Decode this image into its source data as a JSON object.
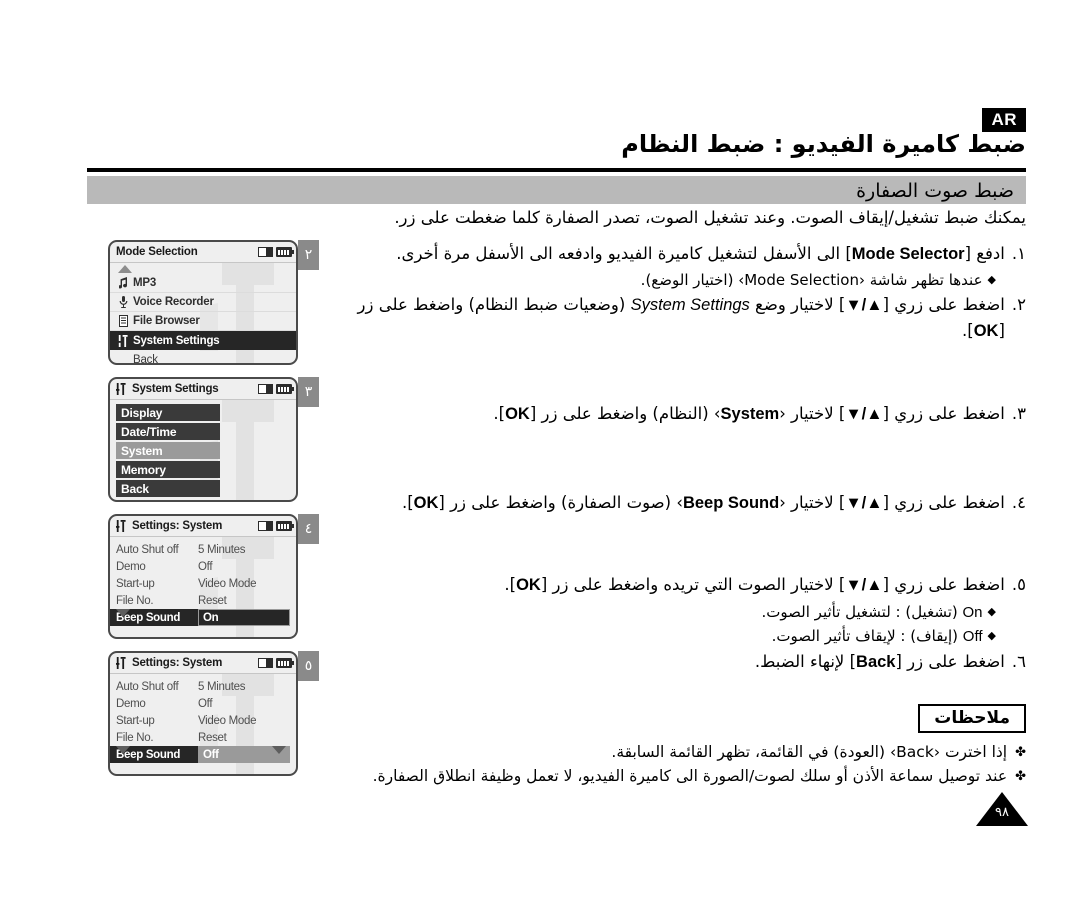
{
  "header": {
    "language_badge": "AR",
    "title": "ضبط كاميرة الفيديو : ضبط النظام",
    "subtitle": "ضبط صوت الصفارة"
  },
  "intro": "يمكنك ضبط تشغيل/إيقاف الصوت. وعند تشغيل الصوت، تصدر الصفارة كلما ضغطت على زر.",
  "steps": [
    {
      "number": "١.",
      "text_before": "ادفع [",
      "latin": "Mode Selector",
      "text_after": "] الى الأسفل لتشغيل كاميرة الفيديو وادفعه الى الأسفل مرة أخرى.",
      "sub": "عندها تظهر شاشة ‹Mode Selection› (اختيار الوضع)."
    },
    {
      "number": "٢.",
      "text_before": "اضغط على زري [",
      "latin": "▼/▲",
      "mid": "] لاختيار وضع",
      "latin2": "System Settings",
      "text_after": "(وضعيات ضبط النظام) واضغط على زر [",
      "latin3": "OK",
      "tail": "]."
    },
    {
      "number": "٣.",
      "text_before": "اضغط على زري [",
      "latin": "▼/▲",
      "mid": "] لاختيار ‹",
      "latin2": "System",
      "text_after": "› (النظام) واضغط على زر [",
      "latin3": "OK",
      "tail": "]."
    },
    {
      "number": "٤.",
      "text_before": "اضغط على زري [",
      "latin": "▼/▲",
      "mid": "] لاختيار ‹",
      "latin2": "Beep Sound",
      "text_after": "› (صوت الصفارة) واضغط على زر [",
      "latin3": "OK",
      "tail": "]."
    },
    {
      "number": "٥.",
      "text_before": "اضغط على زري [",
      "latin": "▼/▲",
      "mid": "] لاختيار الصوت التي تريده واضغط على زر [",
      "latin3": "OK",
      "tail": "].",
      "sub_on": "(تشغيل) : لتشغيل تأثير الصوت.",
      "sub_on_latin": "On",
      "sub_off": "(إيقاف) : لإيقاف تأثير الصوت.",
      "sub_off_latin": "Off"
    },
    {
      "number": "٦.",
      "text_before": "اضغط على زر [",
      "latin": "Back",
      "text_after": "] لإنهاء الضبط."
    }
  ],
  "notes": {
    "title": "ملاحظات",
    "bullet": "✤",
    "items": [
      "إذا اخترت ‹Back› (العودة) في القائمة، تظهر القائمة السابقة.",
      "عند توصيل سماعة الأذن أو سلك لصوت/الصورة الى كاميرة الفيديو، لا تعمل وظيفة انطلاق الصفارة."
    ]
  },
  "page_number": "٩٨",
  "screens": [
    {
      "badge": "٢",
      "title": "Mode Selection",
      "type": "mode-list",
      "items": [
        {
          "icon": "music-note-icon",
          "label": "MP3",
          "state": "normal"
        },
        {
          "icon": "microphone-icon",
          "label": "Voice Recorder",
          "state": "normal"
        },
        {
          "icon": "document-icon",
          "label": "File Browser",
          "state": "normal"
        },
        {
          "icon": "settings-sliders-icon",
          "label": "System Settings",
          "state": "selected"
        },
        {
          "icon": "none",
          "label": "Back",
          "state": "plain"
        }
      ]
    },
    {
      "badge": "٣",
      "title": "System Settings",
      "title_icon": "settings-sliders-icon",
      "type": "button-stack",
      "buttons": [
        {
          "label": "Display",
          "state": "normal"
        },
        {
          "label": "Date/Time",
          "state": "normal"
        },
        {
          "label": "System",
          "state": "highlight"
        },
        {
          "label": "Memory",
          "state": "normal"
        },
        {
          "label": "Back",
          "state": "normal"
        }
      ]
    },
    {
      "badge": "٤",
      "title": "Settings: System",
      "title_icon": "settings-sliders-icon",
      "type": "settings-table",
      "rows": [
        {
          "key": "Auto Shut off",
          "value": "5 Minutes",
          "state": "normal"
        },
        {
          "key": "Demo",
          "value": "Off",
          "state": "normal"
        },
        {
          "key": "Start-up",
          "value": "Video Mode",
          "state": "normal"
        },
        {
          "key": "File No.",
          "value": "Reset",
          "state": "normal"
        },
        {
          "key": "Beep Sound",
          "value": "On",
          "state": "selected-dark"
        }
      ],
      "scroll_down": true,
      "scroll_up_right": false,
      "scroll_down_right": false
    },
    {
      "badge": "٥",
      "title": "Settings: System",
      "title_icon": "settings-sliders-icon",
      "type": "settings-table",
      "rows": [
        {
          "key": "Auto Shut off",
          "value": "5 Minutes",
          "state": "normal"
        },
        {
          "key": "Demo",
          "value": "Off",
          "state": "normal"
        },
        {
          "key": "Start-up",
          "value": "Video Mode",
          "state": "normal"
        },
        {
          "key": "File No.",
          "value": "Reset",
          "state": "normal"
        },
        {
          "key": "Beep Sound",
          "value": "Off",
          "state": "selected-gray"
        }
      ],
      "scroll_down": true,
      "scroll_up_right": true,
      "scroll_down_right": true
    }
  ],
  "status_icons": {
    "card": "memory-card-icon",
    "battery": "battery-icon"
  },
  "colors": {
    "subtitle_bar": "#b9b9b9",
    "badge": "#8a8a8a",
    "screen_bg": "#efefef",
    "selected_dark": "#262626",
    "selected_gray": "#9a9a9a"
  }
}
